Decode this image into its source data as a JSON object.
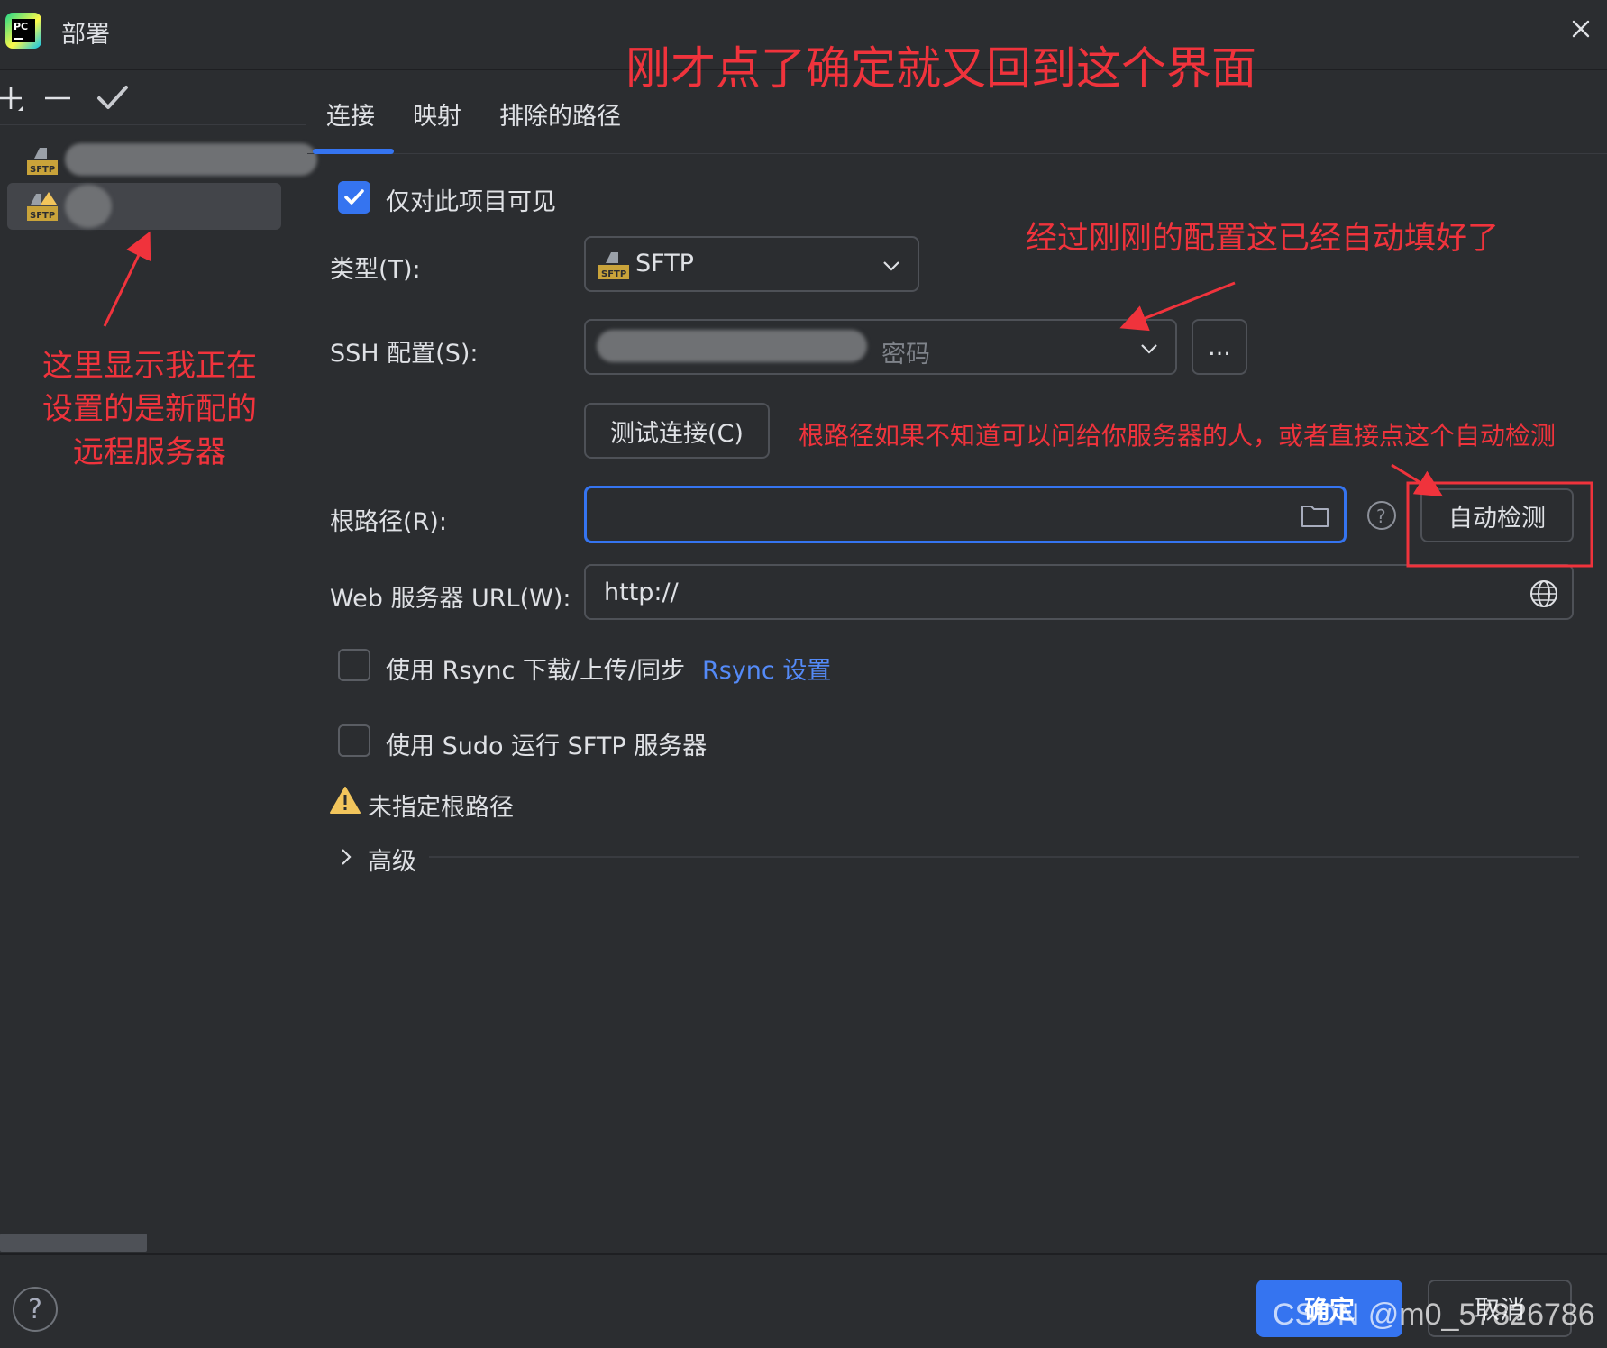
{
  "window": {
    "title": "部署",
    "app_icon_text": "PC"
  },
  "left_panel": {
    "toolbar": [
      "add-icon",
      "remove-icon",
      "check-icon"
    ],
    "servers": [
      {
        "icon": "sftp-icon",
        "name_redacted": true,
        "selected": false,
        "warning": false
      },
      {
        "icon": "sftp-warning-icon",
        "name_redacted": true,
        "selected": true,
        "warning": true
      }
    ]
  },
  "tabs": {
    "connection": "连接",
    "mapping": "映射",
    "excluded_paths": "排除的路径",
    "active": "连接"
  },
  "form": {
    "visible_only_this_project": {
      "label": "仅对此项目可见",
      "checked": true
    },
    "type": {
      "label": "类型(T):",
      "value": "SFTP"
    },
    "ssh_config": {
      "label": "SSH 配置(S):",
      "value_suffix": "密码",
      "more_button": "..."
    },
    "test_connection_button": "测试连接(C)",
    "root_path": {
      "label": "根路径(R):",
      "value": "",
      "autodetect_button": "自动检测"
    },
    "web_url": {
      "label": "Web 服务器 URL(W):",
      "value": "http://"
    },
    "use_rsync": {
      "label": "使用 Rsync 下载/上传/同步",
      "checked": false,
      "link": "Rsync 设置"
    },
    "use_sudo": {
      "label": "使用 Sudo 运行 SFTP 服务器",
      "checked": false
    },
    "warning": "未指定根路径",
    "advanced": "高级"
  },
  "footer": {
    "help": "?",
    "ok": "确定",
    "cancel": "取消"
  },
  "annotations": {
    "top": "刚才点了确定就又回到这个界面",
    "ssh": "经过刚刚的配置这已经自动填好了",
    "root": "根路径如果不知道可以问给你服务器的人，或者直接点这个自动检测",
    "left_line1": "这里显示我正在",
    "left_line2": "设置的是新配的",
    "left_line3": "远程服务器"
  },
  "watermark": "CSDN @m0_57826786",
  "colors": {
    "accent": "#3574f0",
    "annotation": "#f0333c",
    "warning": "#f2c55c",
    "link": "#548af7"
  }
}
